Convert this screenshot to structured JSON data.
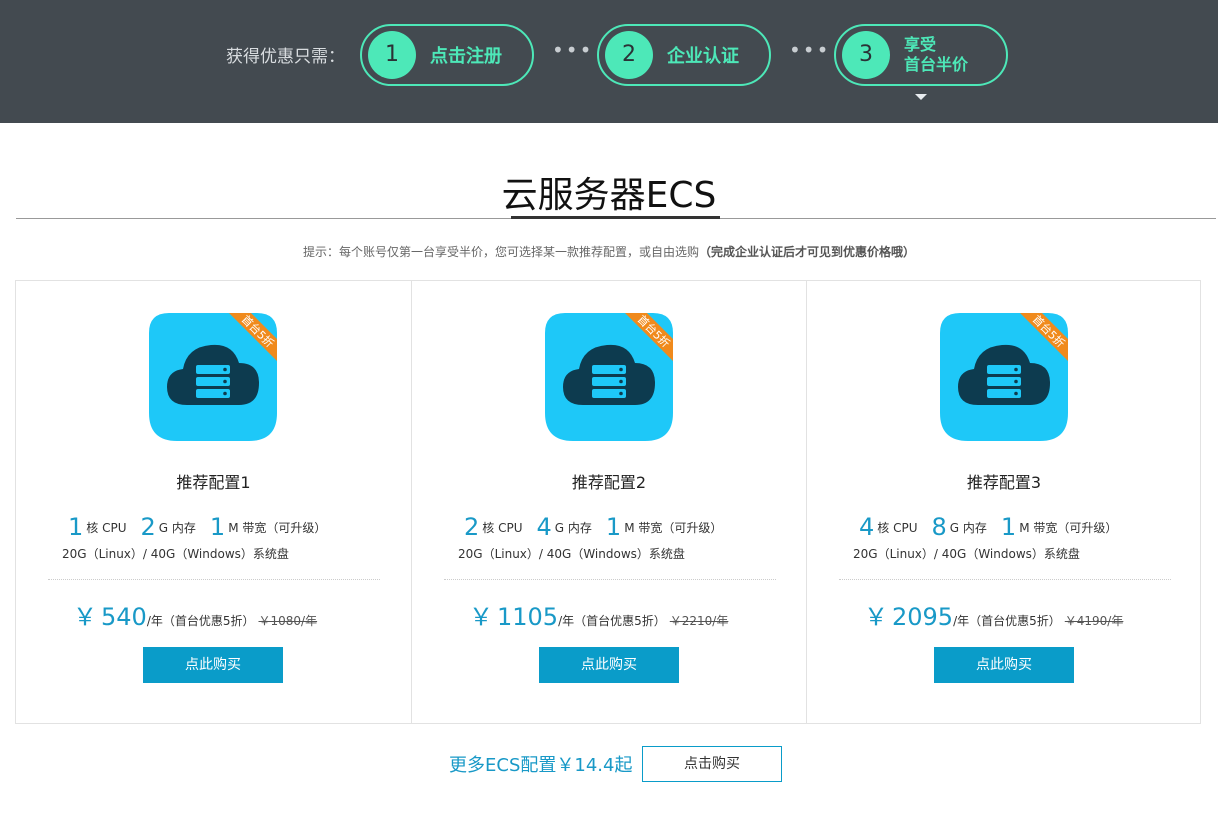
{
  "banner": {
    "label": "获得优惠只需：",
    "steps": [
      {
        "num": "1",
        "label": "点击注册"
      },
      {
        "num": "2",
        "label": "企业认证"
      },
      {
        "num": "3",
        "label_line1": "享受",
        "label_line2": "首台半价"
      }
    ],
    "dots": "•••"
  },
  "section": {
    "title": "云服务器ECS",
    "hint_plain": "提示：每个账号仅第一台享受半价，您可选择某一款推荐配置，或自由选购",
    "hint_bold": "（完成企业认证后才可见到优惠价格哦）"
  },
  "badge_text": "首台5折",
  "colors": {
    "banner_bg": "#434a50",
    "accent_green": "#4de8b8",
    "icon_bg": "#1ec8f8",
    "badge": "#f08a1c",
    "price_blue": "#1999c7",
    "button_blue": "#0a9cc9"
  },
  "cards": [
    {
      "name": "推荐配置1",
      "cpu": "1",
      "cpu_unit": "核 CPU",
      "mem": "2",
      "mem_unit": "G 内存",
      "bw": "1",
      "bw_unit": "M 带宽（可升级）",
      "disk": "20G（Linux）/ 40G（Windows）系统盘",
      "yen": "￥",
      "price": "540",
      "price_unit": "/年（首台优惠5折）",
      "old_price": "￥1080/年",
      "button": "点此购买"
    },
    {
      "name": "推荐配置2",
      "cpu": "2",
      "cpu_unit": "核 CPU",
      "mem": "4",
      "mem_unit": "G 内存",
      "bw": "1",
      "bw_unit": "M 带宽（可升级）",
      "disk": "20G（Linux）/ 40G（Windows）系统盘",
      "yen": "￥",
      "price": "1105",
      "price_unit": "/年（首台优惠5折）",
      "old_price": "￥2210/年",
      "button": "点此购买"
    },
    {
      "name": "推荐配置3",
      "cpu": "4",
      "cpu_unit": "核 CPU",
      "mem": "8",
      "mem_unit": "G 内存",
      "bw": "1",
      "bw_unit": "M 带宽（可升级）",
      "disk": "20G（Linux）/ 40G（Windows）系统盘",
      "yen": "￥",
      "price": "2095",
      "price_unit": "/年（首台优惠5折）",
      "old_price": "￥4190/年",
      "button": "点此购买"
    }
  ],
  "footer": {
    "more_text": "更多ECS配置￥14.4起",
    "more_button": "点击购买"
  }
}
